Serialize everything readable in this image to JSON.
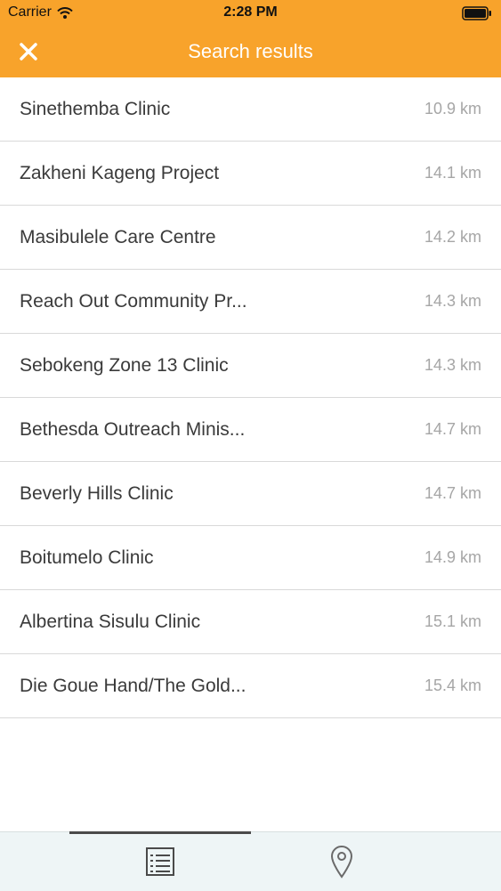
{
  "status_bar": {
    "carrier": "Carrier",
    "time": "2:28 PM"
  },
  "header": {
    "title": "Search results",
    "close_icon": "close-icon",
    "accent_color": "#f8a32b"
  },
  "results": [
    {
      "name": "Sinethemba Clinic",
      "distance": "10.9 km"
    },
    {
      "name": "Zakheni Kageng Project",
      "distance": "14.1 km"
    },
    {
      "name": "Masibulele Care Centre",
      "distance": "14.2 km"
    },
    {
      "name": "Reach Out Community Pr...",
      "distance": "14.3 km"
    },
    {
      "name": "Sebokeng Zone 13 Clinic",
      "distance": "14.3 km"
    },
    {
      "name": "Bethesda Outreach Minis...",
      "distance": "14.7 km"
    },
    {
      "name": "Beverly Hills Clinic",
      "distance": "14.7 km"
    },
    {
      "name": "Boitumelo Clinic",
      "distance": "14.9 km"
    },
    {
      "name": "Albertina Sisulu Clinic",
      "distance": "15.1 km"
    },
    {
      "name": "Die Goue Hand/The Gold...",
      "distance": "15.4 km"
    }
  ],
  "tab_bar": {
    "tabs": [
      {
        "icon": "list-icon",
        "selected": true
      },
      {
        "icon": "map-pin-icon",
        "selected": false
      }
    ]
  }
}
